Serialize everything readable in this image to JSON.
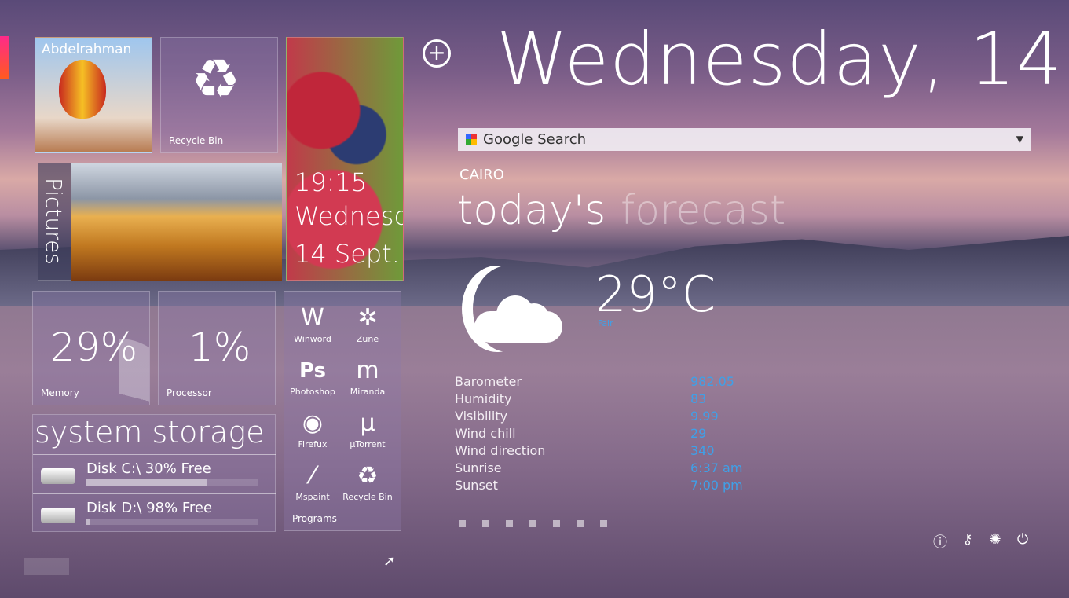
{
  "header": {
    "date": "Wednesday, 14",
    "add_icon": "plus-circle-icon"
  },
  "search": {
    "label": "Google Search"
  },
  "weather": {
    "city": "CAIRO",
    "title_a": "today's",
    "title_b": "forecast",
    "temp": "29°C",
    "condition": "Fair",
    "rows": [
      {
        "label": "Barometer",
        "value": "982.05"
      },
      {
        "label": "Humidity",
        "value": "83"
      },
      {
        "label": "Visibility",
        "value": "9.99"
      },
      {
        "label": "Wind chill",
        "value": "29"
      },
      {
        "label": "Wind direction",
        "value": "340"
      },
      {
        "label": "Sunrise",
        "value": "6:37 am"
      },
      {
        "label": "Sunset",
        "value": "7:00 pm"
      }
    ]
  },
  "tiles": {
    "user": "Abdelrahman",
    "recycle": "Recycle Bin",
    "pictures": "Pictures",
    "clock_time": "19:15",
    "clock_day": "Wednesday",
    "clock_date": "14 Sept.",
    "memory_value": "29%",
    "memory_label": "Memory",
    "memory_fraction": 0.29,
    "cpu_value": "1%",
    "cpu_label": "Processor"
  },
  "storage": {
    "title": "system storage",
    "disks": [
      {
        "label": "Disk C:\\ 30% Free",
        "free": 0.3
      },
      {
        "label": "Disk D:\\ 98% Free",
        "free": 0.02
      }
    ]
  },
  "programs": {
    "title": "Programs",
    "items": [
      {
        "label": "Winword",
        "icon": "word-icon"
      },
      {
        "label": "Zune",
        "icon": "zune-icon"
      },
      {
        "label": "Photoshop",
        "icon": "photoshop-icon"
      },
      {
        "label": "Miranda",
        "icon": "miranda-icon"
      },
      {
        "label": "Firefux",
        "icon": "firefox-icon"
      },
      {
        "label": "µTorrent",
        "icon": "utorrent-icon"
      },
      {
        "label": "Mspaint",
        "icon": "paint-icon"
      },
      {
        "label": "Recycle Bin",
        "icon": "recycle-icon"
      }
    ]
  },
  "system_icons": [
    "info-icon",
    "key-icon",
    "loading-icon",
    "power-icon"
  ]
}
